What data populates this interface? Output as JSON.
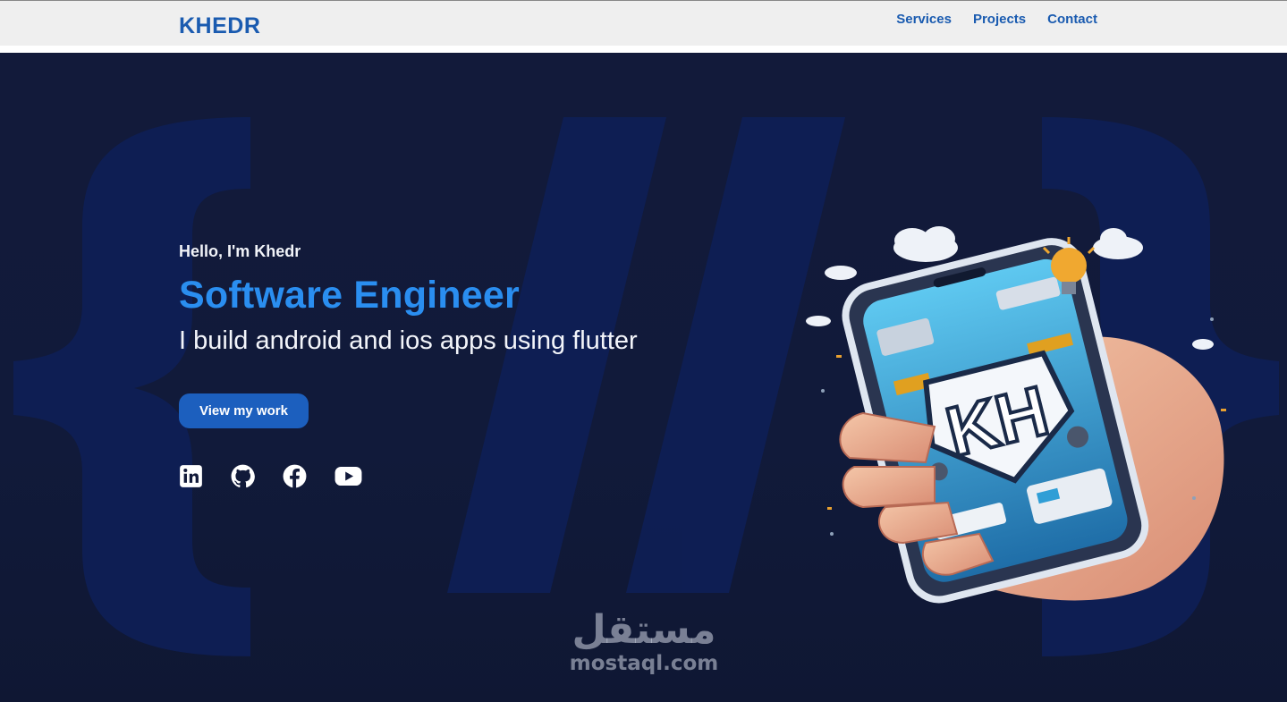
{
  "nav": {
    "brand": "KHEDR",
    "links": [
      "Services",
      "Projects",
      "Contact"
    ]
  },
  "hero": {
    "greeting": "Hello, I'm Khedr",
    "headline": "Software Engineer",
    "subline": "I build android and ios apps using flutter",
    "cta_label": "View my work",
    "socials": [
      "linkedin-icon",
      "github-icon",
      "facebook-icon",
      "youtube-icon"
    ],
    "illustration_text": "KH",
    "background_glyphs": "{/}"
  },
  "watermark": {
    "arabic": "مستقل",
    "latin": "mostaql.com"
  },
  "colors": {
    "brand_blue": "#1a5bb0",
    "headline_blue": "#2a8ef0",
    "button_blue": "#1c5fbe",
    "hero_bg": "#121a3a",
    "nav_bg": "#efefef"
  }
}
